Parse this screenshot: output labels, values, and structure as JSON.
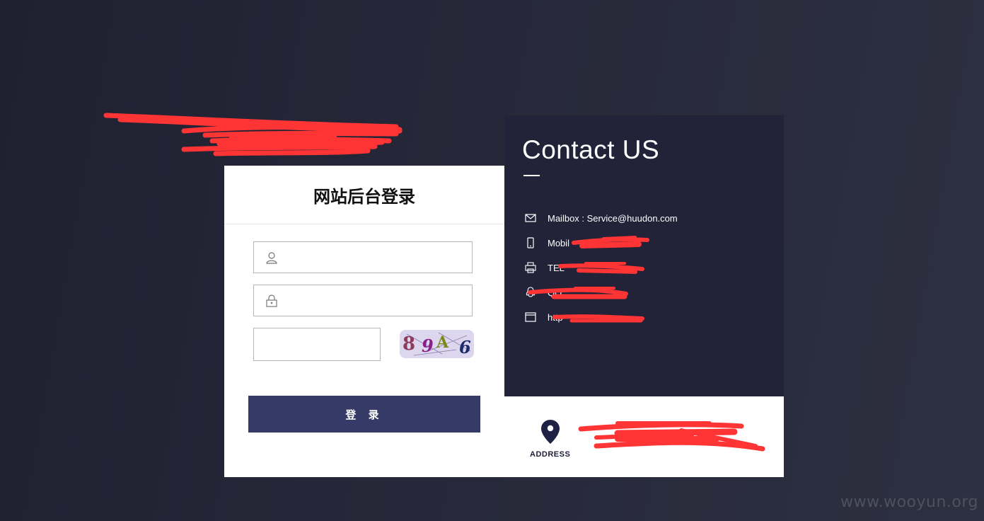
{
  "login": {
    "title": "网站后台登录",
    "username_placeholder": "",
    "password_placeholder": "",
    "captcha_placeholder": "",
    "captcha_text": "89A6",
    "submit_label": "登 录"
  },
  "contact": {
    "title": "Contact US",
    "items": [
      {
        "icon": "mail-icon",
        "text": "Mailbox : Service@huudon.com"
      },
      {
        "icon": "mobile-icon",
        "text": "Mobil"
      },
      {
        "icon": "printer-icon",
        "text": "TEL"
      },
      {
        "icon": "qq-icon",
        "text": "QQ"
      },
      {
        "icon": "browser-icon",
        "text": "http"
      }
    ]
  },
  "address": {
    "label": "ADDRESS",
    "text": ""
  },
  "watermark": "www.wooyun.org",
  "colors": {
    "button": "#353a66",
    "panel": "#222238",
    "redaction": "#ff3333"
  }
}
